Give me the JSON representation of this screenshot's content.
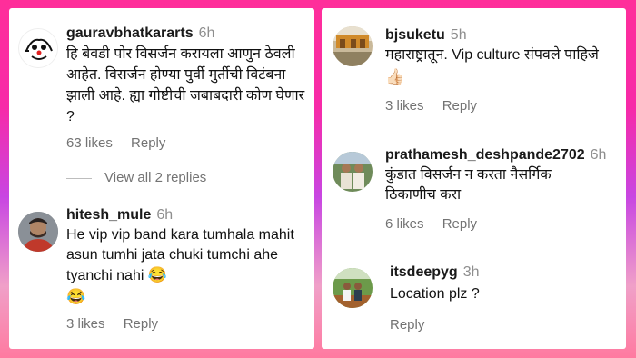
{
  "left_column": {
    "comments": [
      {
        "username": "gauravbhatkararts",
        "time": "6h",
        "text": "हि बेवडी पोर विसर्जन करायला आणुन ठेवली आहेत. विसर्जन होण्या पुर्वी मुर्तीची विटंबना झाली आहे. ह्या गोष्टीची जबाबदारी कोण घेणार ?",
        "likes": "63 likes",
        "reply": "Reply",
        "view_replies": "View all 2 replies"
      },
      {
        "username": "hitesh_mule",
        "time": "6h",
        "text": "He vip vip band kara tumhala mahit asun tumhi jata chuki tumchi ahe tyanchi nahi",
        "emoji_inline": "😂",
        "emoji_line": "😂",
        "likes": "3 likes",
        "reply": "Reply"
      }
    ]
  },
  "right_column": {
    "comments": [
      {
        "username": "bjsuketu",
        "time": "5h",
        "text": "महाराष्ट्रातून. Vip culture संपवले पाहिजे",
        "emoji_line": "👍🏻",
        "likes": "3 likes",
        "reply": "Reply"
      },
      {
        "username": "prathamesh_deshpande2702",
        "time": "6h",
        "text": "कुंडात विसर्जन न करता नैसर्गिक ठिकाणीच करा",
        "likes": "6 likes",
        "reply": "Reply"
      },
      {
        "username": "itsdeepyg",
        "time": "3h",
        "text": "Location plz ?",
        "reply": "Reply"
      }
    ]
  }
}
